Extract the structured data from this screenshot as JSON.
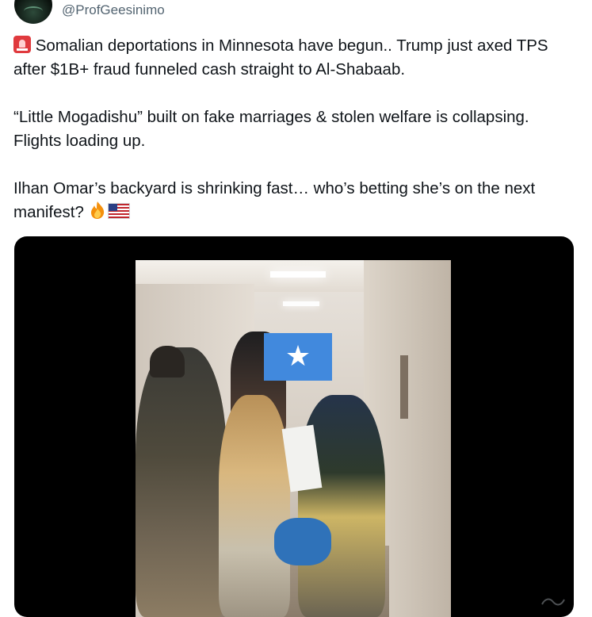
{
  "tweet": {
    "handle": "@ProfGeesinimo",
    "paragraphs": [
      {
        "lead_emoji": "police-car-light",
        "text": "Somalian deportations in Minnesota have begun.. Trump just axed TPS after $1B+ fraud funneled cash straight to Al-Shabaab."
      },
      {
        "text": "“Little Mogadishu” built on fake marriages & stolen welfare is collapsing. Flights loading up."
      },
      {
        "text": "Ilhan Omar’s backyard is shrinking fast… who’s betting she’s on the next manifest?",
        "trailing_emojis": [
          "fire",
          "us-flag"
        ]
      }
    ],
    "media": {
      "type": "video",
      "overlay_flag": "somalia-flag",
      "overlay_star": "★"
    }
  },
  "colors": {
    "text": "#0f1419",
    "secondary_text": "#536471",
    "media_background": "#000000",
    "somalia_blue": "#4189dd"
  }
}
